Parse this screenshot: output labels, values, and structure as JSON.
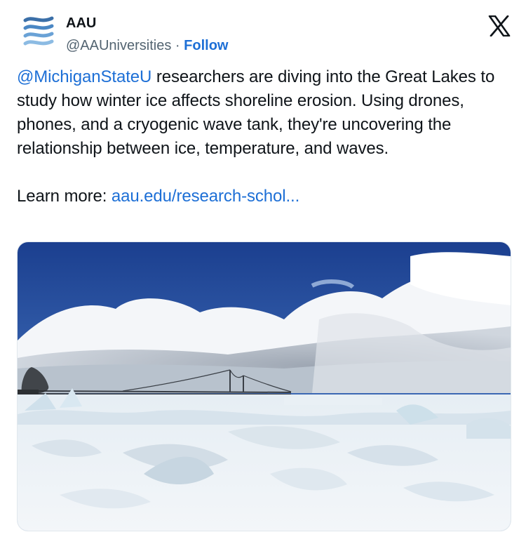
{
  "account": {
    "display_name": "AAU",
    "handle": "@AAUniversities",
    "separator": "·",
    "follow_label": "Follow",
    "avatar_icon": "aau-waves-logo-icon"
  },
  "platform_icon": "x-logo-icon",
  "tweet": {
    "mention": "@MichiganStateU",
    "body": " researchers are diving into the Great Lakes to study how winter ice affects shoreline erosion. Using drones, phones, and a cryogenic wave tank, they're uncovering the relationship between ice, temperature, and waves.",
    "learn_more_label": "Learn more: ",
    "learn_more_link": "aau.edu/research-schol..."
  },
  "media": {
    "kind": "photo",
    "subject": "frozen lake shoreline with suspension bridge under cloudy sky"
  },
  "colors": {
    "link": "#1d6fd6",
    "text": "#0f1419",
    "secondary": "#536471"
  }
}
